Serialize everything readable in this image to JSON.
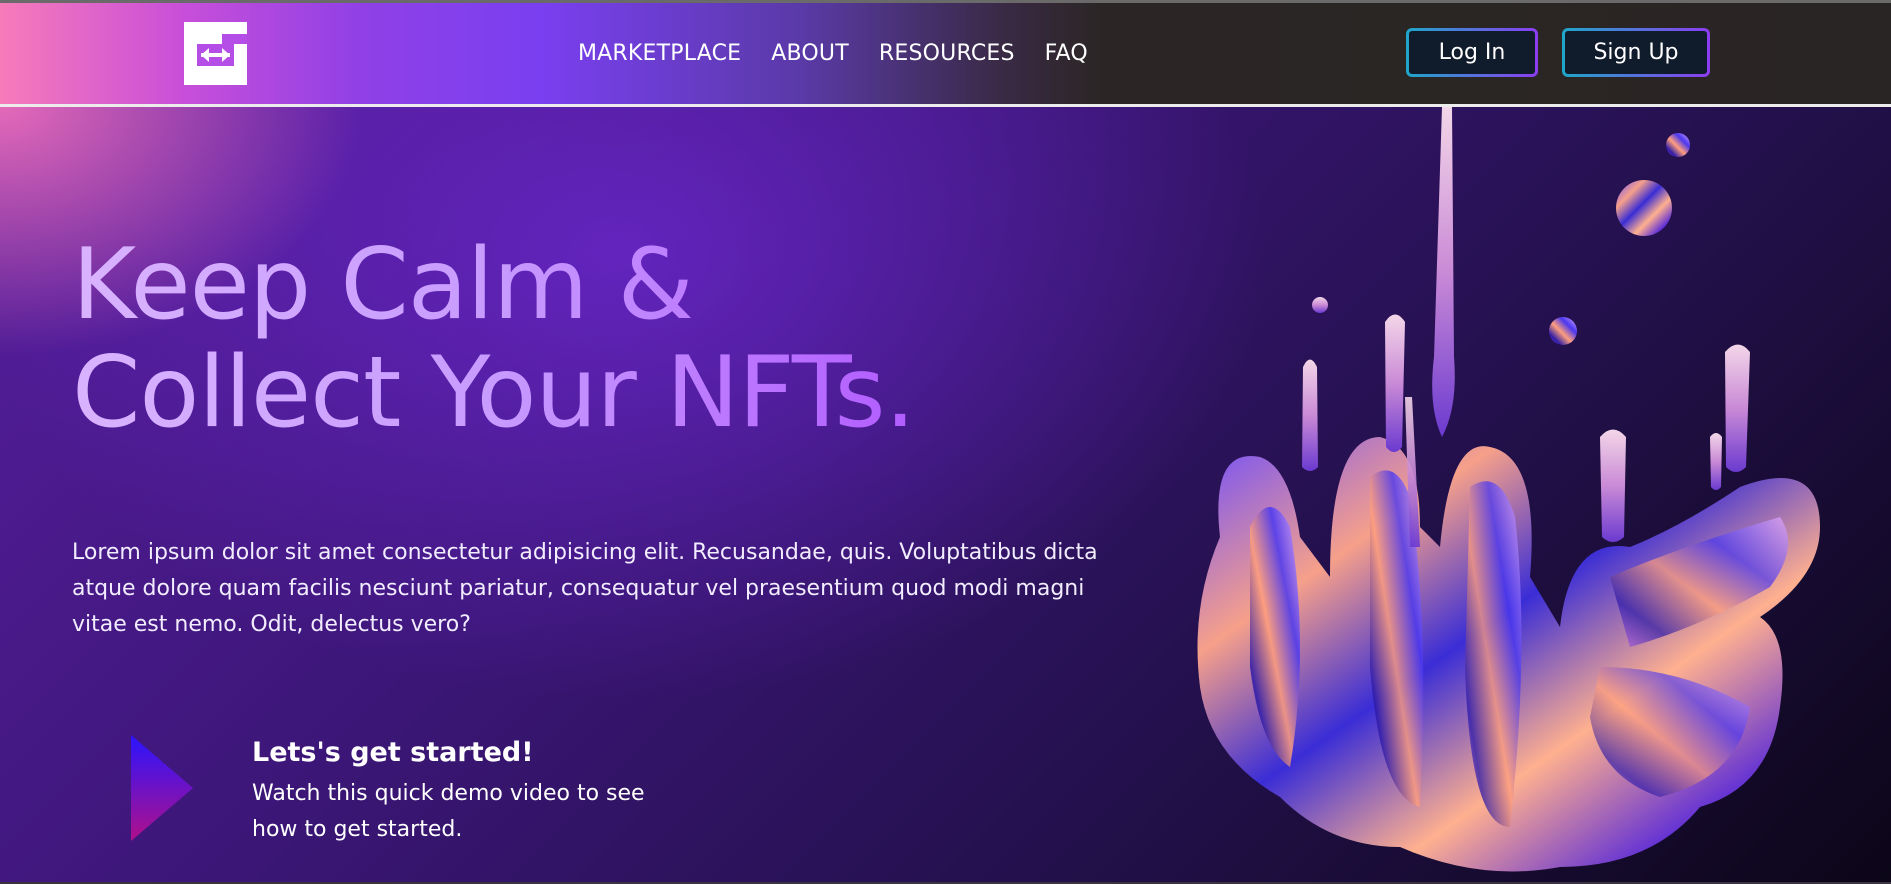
{
  "header": {
    "logo_icon": "exchange-arrows-logo-icon",
    "nav": [
      {
        "label": "MARKETPLACE"
      },
      {
        "label": "ABOUT"
      },
      {
        "label": "RESOURCES"
      },
      {
        "label": "FAQ"
      }
    ],
    "login_label": "Log In",
    "signup_label": "Sign Up"
  },
  "hero": {
    "headline_line1": "Keep Calm &",
    "headline_line2": "Collect Your NFTs.",
    "body": "Lorem ipsum dolor sit amet consectetur adipisicing elit. Recusandae, quis. Voluptatibus dicta atque dolore quam facilis nesciunt pariatur, consequatur vel praesentium quod modi magni vitae est nemo. Odit, delectus vero?",
    "cta_title": "Lets's get started!",
    "cta_subtitle": "Watch this quick demo video to see how to get started.",
    "play_icon": "play-triangle-icon",
    "art_icon": "liquid-chrome-splash-illustration"
  },
  "colors": {
    "header_gradient_start": "#f77bb9",
    "header_gradient_mid": "#7a3ff0",
    "header_dark": "#292524",
    "button_bg": "#101b2c",
    "button_border_start": "#1fa7c9",
    "button_border_end": "#8b3df0",
    "headline_start": "#d9b3ff",
    "headline_end": "#b25cff",
    "play_start": "#2a14ff",
    "play_end": "#b0108a"
  }
}
